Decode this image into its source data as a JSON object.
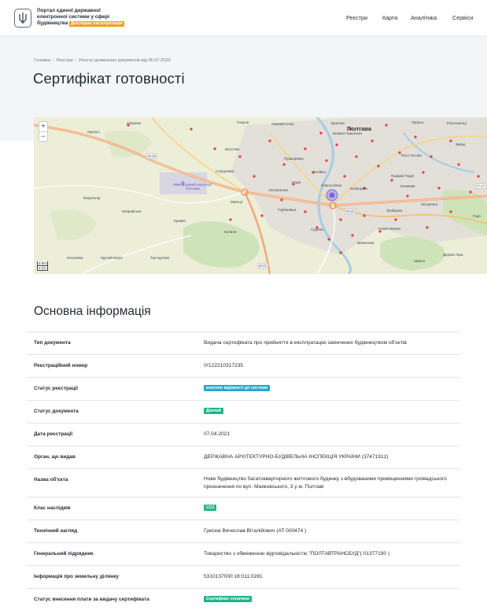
{
  "header": {
    "brand_title": "Портал єдиної державної електронної системи у сфері будівництва",
    "badge": "Дослідна експлуатація",
    "nav": [
      "Реєстри",
      "Карта",
      "Аналітика",
      "Сервіси"
    ]
  },
  "breadcrumb": [
    "Головна",
    "Реєстри",
    "Реєстр дозвільних документів від 06.07.2020"
  ],
  "page_title": "Сертифікат готовності",
  "map": {
    "zoom_in": "+",
    "zoom_out": "−",
    "scale_km": "2 km",
    "scale_mi": "1 mi",
    "city_label": "Полтава",
    "labels": [
      "Абазівка",
      "Карпусі",
      "Гожули",
      "Авиамістечко",
      "Браїлки",
      "Тераса",
      "Розсошенці",
      "Пушкарівка",
      "Шостаки",
      "Супрунівка",
      "Огнівка",
      "Новосєлівка",
      "Кобищани",
      "Климове",
      "Пост-Острів",
      "Правий Поділ",
      "Яківці",
      "Ближні Павленки",
      "Сади",
      "Автоколона",
      "Мильці",
      "Копили",
      "Гожули",
      "Вакуленці",
      "Коврайське",
      "Кривки",
      "Міжнародний аеропорт Полтава",
      "Горбанівка",
      "Судова",
      "Затуринці",
      "Шевченки",
      "Гора",
      "Трибужка",
      "Нижні Млини",
      "Шмиги",
      "Клюковка",
      "Крутий Берег",
      "Дідова Гора",
      "Тахтаулове"
    ],
    "roads": [
      "М-03",
      "М-03",
      "М-22",
      "Т-17"
    ]
  },
  "section_title": "Основна інформація",
  "colors": {
    "accent_blue": "#2aa7c9",
    "accent_green": "#22b389",
    "badge_orange": "#f0a020",
    "marker_purple": "#7a63e0"
  },
  "rows": [
    {
      "label": "Тип документа",
      "value": "Видача сертифіката про прийняття в експлуатацію закінчених будівництвом об'єктів"
    },
    {
      "label": "Реєстраційний номер",
      "value": "ІУ122210317235"
    },
    {
      "label": "Статус реєстрації",
      "badge": "внесено відомості до системи",
      "badge_color": "blue"
    },
    {
      "label": "Статус документа",
      "badge": "Діючий",
      "badge_color": "green"
    },
    {
      "label": "Дата реєстрації",
      "value": "07.04.2021"
    },
    {
      "label": "Орган, що видав",
      "value": "ДЕРЖАВНА АРХІТЕКТУРНО-БУДІВЕЛЬНА ІНСПЕКЦІЯ УКРАЇНИ (37471912)"
    },
    {
      "label": "Назва об'єкта",
      "value": "Нове будівництво багатоквартирного житлового будинку з вбудованими приміщеннями громадського призначення по вул. Маяковського, 3 у м. Полтаві"
    },
    {
      "label": "Клас наслідків",
      "badge": "СС2",
      "badge_color": "green"
    },
    {
      "label": "Технічний нагляд",
      "value": "Грисюк Вячеслав Віталійович (АТ 000474 )"
    },
    {
      "label": "Генеральний підрядник",
      "value": "Товариство з обмеженою відповідальністю \"ПОЛТАВТРАНСБУД\"( 01377190 )"
    },
    {
      "label": "Інформація про земельну ділянку",
      "value": "5310137000:18:011:0281"
    },
    {
      "label": "Статус внесення плати за видачу сертифіката",
      "badge": "Сертифікат сплачено",
      "badge_color": "green"
    }
  ]
}
